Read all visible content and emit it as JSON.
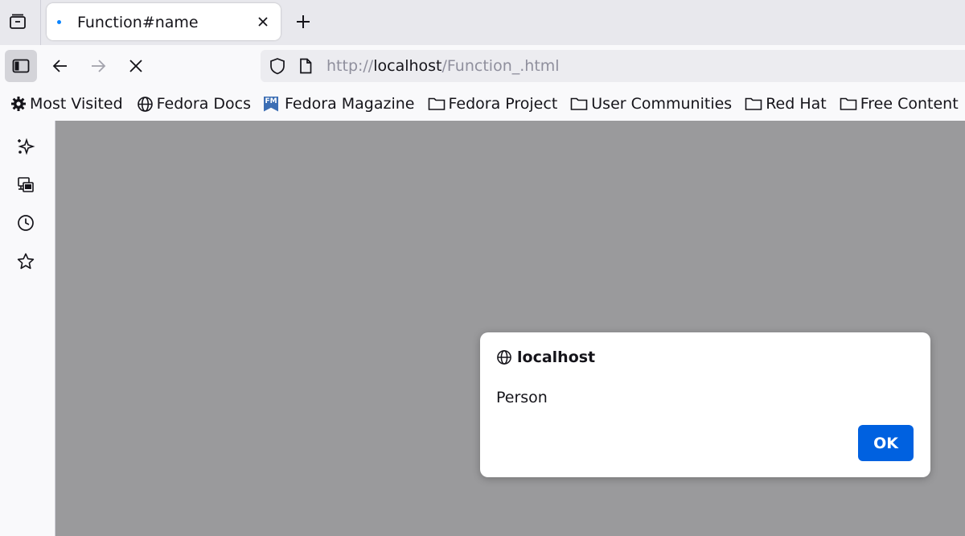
{
  "tab": {
    "title": "Function#name"
  },
  "urlbar": {
    "scheme": "http://",
    "host": "localhost",
    "path": "/Function_.html"
  },
  "bookmarks": [
    {
      "label": "Most Visited",
      "icon": "gear-icon"
    },
    {
      "label": "Fedora Docs",
      "icon": "globe-icon"
    },
    {
      "label": "Fedora Magazine",
      "icon": "fedora-magazine-icon",
      "icon_text": "FM"
    },
    {
      "label": "Fedora Project",
      "icon": "folder-icon"
    },
    {
      "label": "User Communities",
      "icon": "folder-icon"
    },
    {
      "label": "Red Hat",
      "icon": "folder-icon"
    },
    {
      "label": "Free Content",
      "icon": "folder-icon"
    }
  ],
  "sidebar": [
    "ai-chatbot-icon",
    "synced-tabs-icon",
    "history-icon",
    "bookmarks-star-icon"
  ],
  "dialog": {
    "origin": "localhost",
    "message": "Person",
    "ok_label": "OK"
  },
  "colors": {
    "accent": "#0061e0",
    "loading_dot": "#0a84ff",
    "content_overlay": "#9a9a9c"
  }
}
